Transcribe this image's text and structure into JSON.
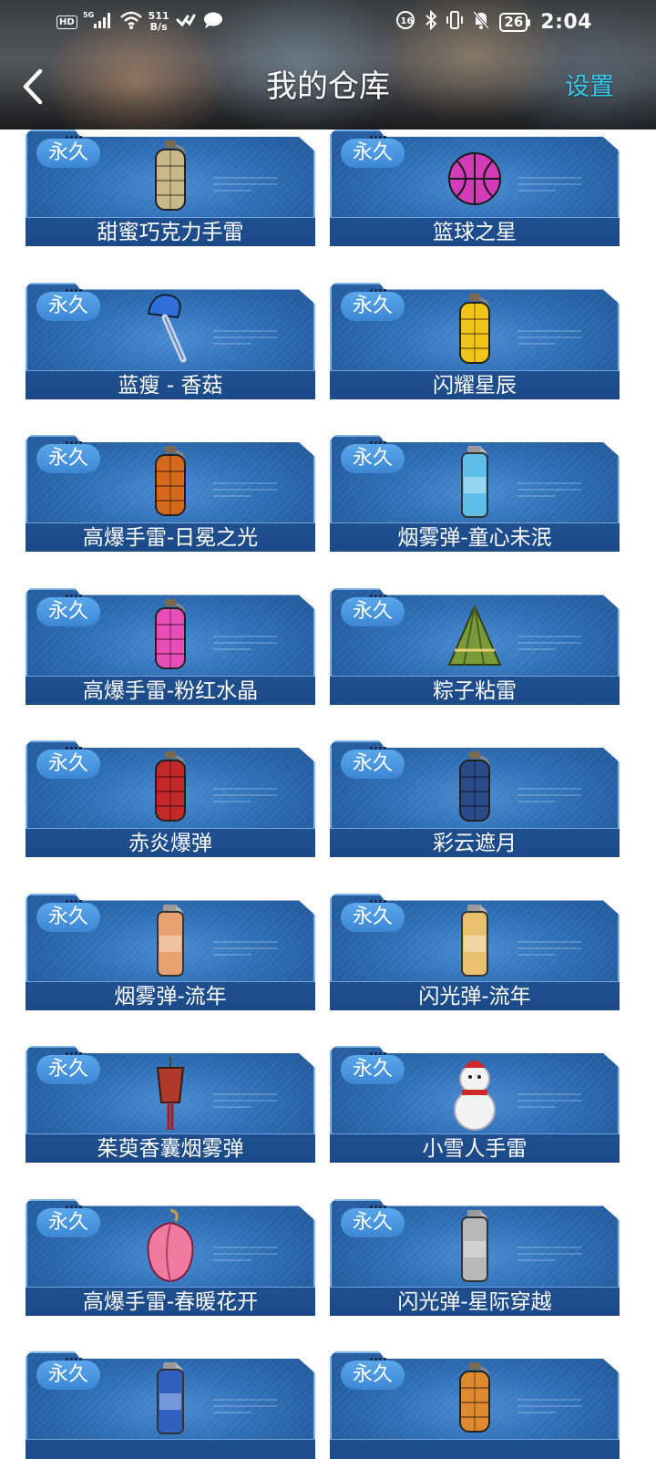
{
  "status_bar": {
    "hd": "HD",
    "network": "5G",
    "speed_value": "511",
    "speed_unit": "B/s",
    "battery": "26",
    "time": "2:04"
  },
  "nav": {
    "back_icon": "chevron-left-icon",
    "title": "我的仓库",
    "settings_label": "设置",
    "settings_color": "#37c6e8"
  },
  "colors": {
    "card_top": "#4a8bd0",
    "card_bottom": "#255da0",
    "name_bar": "#1c4a88",
    "tag": "#3d86d4",
    "card_border": "#7cb4e8"
  },
  "items": [
    {
      "tag": "永久",
      "name": "甜蜜巧克力手雷",
      "icon": "grenade-icon",
      "color": "#c9b98a"
    },
    {
      "tag": "永久",
      "name": "篮球之星",
      "icon": "basketball-icon",
      "color": "#d33bb8"
    },
    {
      "tag": "永久",
      "name": "蓝瘦 - 香菇",
      "icon": "mushroom-icon",
      "color": "#2f6ed8"
    },
    {
      "tag": "永久",
      "name": "闪耀星辰",
      "icon": "grenade-icon",
      "color": "#f0c419"
    },
    {
      "tag": "永久",
      "name": "高爆手雷-日冕之光",
      "icon": "grenade-icon",
      "color": "#d2691e"
    },
    {
      "tag": "永久",
      "name": "烟雾弹-童心未泯",
      "icon": "canister-icon",
      "color": "#5ec0e8"
    },
    {
      "tag": "永久",
      "name": "高爆手雷-粉红水晶",
      "icon": "grenade-icon",
      "color": "#e64fb8"
    },
    {
      "tag": "永久",
      "name": "粽子粘雷",
      "icon": "zongzi-icon",
      "color": "#7a9a3a"
    },
    {
      "tag": "永久",
      "name": "赤炎爆弹",
      "icon": "grenade-icon",
      "color": "#c0282a"
    },
    {
      "tag": "永久",
      "name": "彩云遮月",
      "icon": "grenade-icon",
      "color": "#2a4a8a"
    },
    {
      "tag": "永久",
      "name": "烟雾弹-流年",
      "icon": "canister-icon",
      "color": "#e8a070"
    },
    {
      "tag": "永久",
      "name": "闪光弹-流年",
      "icon": "canister-icon",
      "color": "#e8c070"
    },
    {
      "tag": "永久",
      "name": "茱萸香囊烟雾弹",
      "icon": "sachet-icon",
      "color": "#b03a2a"
    },
    {
      "tag": "永久",
      "name": "小雪人手雷",
      "icon": "snowman-icon",
      "color": "#f2f2f2"
    },
    {
      "tag": "永久",
      "name": "高爆手雷-春暖花开",
      "icon": "peach-icon",
      "color": "#f07aa0"
    },
    {
      "tag": "永久",
      "name": "闪光弹-星际穿越",
      "icon": "canister-icon",
      "color": "#b8b8b8"
    },
    {
      "tag": "永久",
      "name": "",
      "icon": "canister-icon",
      "color": "#3060c0"
    },
    {
      "tag": "永久",
      "name": "",
      "icon": "grenade-icon",
      "color": "#e08a30"
    }
  ]
}
